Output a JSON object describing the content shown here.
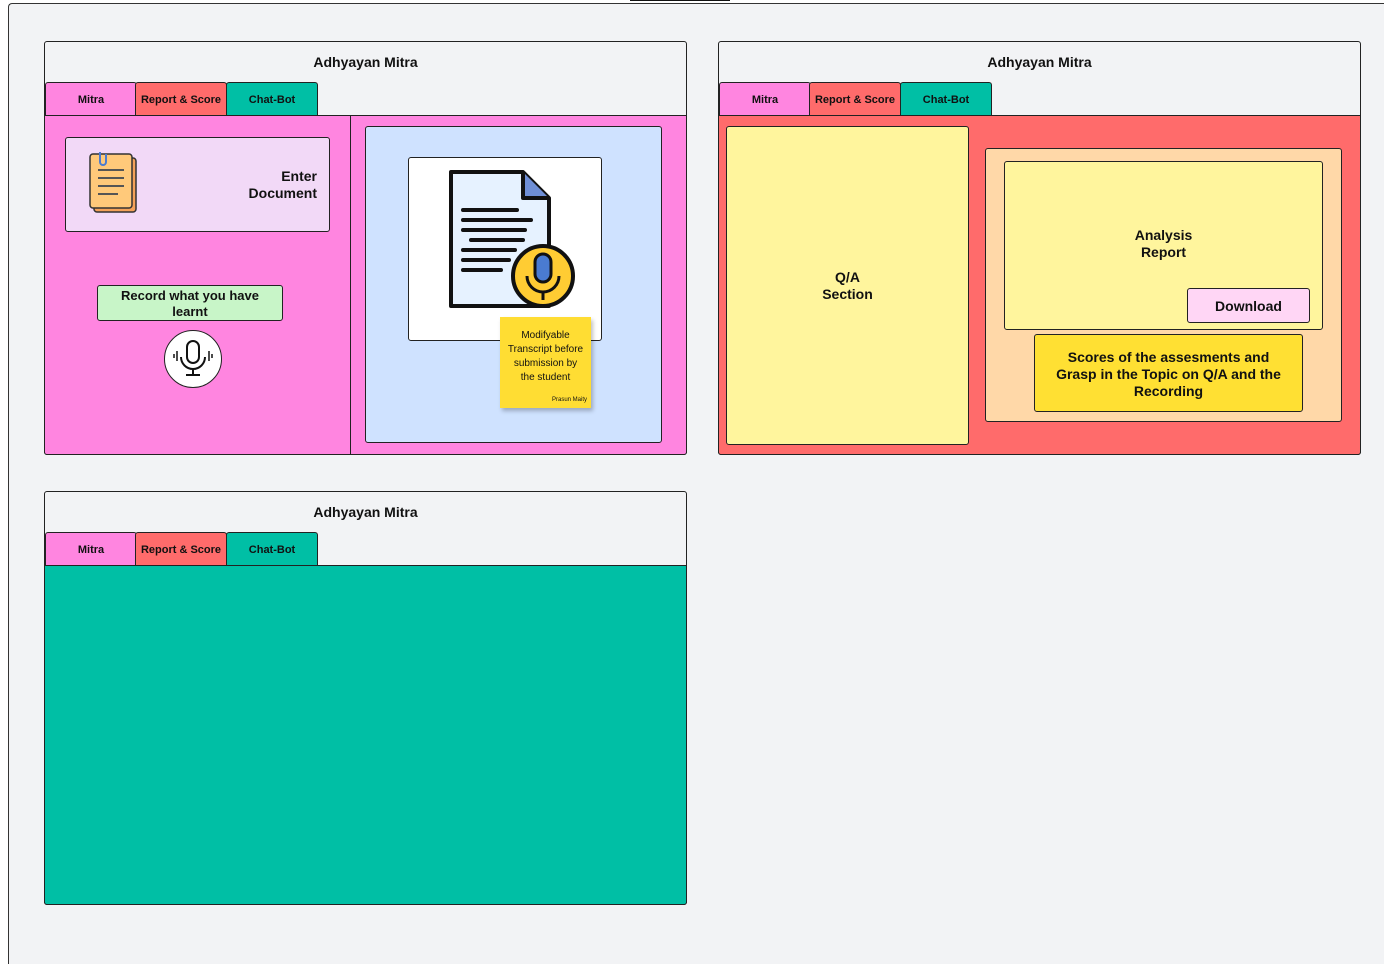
{
  "app": {
    "title": "Adhyayan Mitra",
    "tabs": [
      "Mitra",
      "Report & Score",
      "Chat-Bot"
    ]
  },
  "frame1": {
    "enter_document": [
      "Enter",
      "Document"
    ],
    "record_button": [
      "Record what you have",
      "learnt"
    ],
    "sticky_note": {
      "lines": [
        "Modifyable",
        "Transcript before",
        "submission by",
        "the student"
      ],
      "author": "Prasun Maity"
    }
  },
  "frame2": {
    "qa_section": [
      "Q/A",
      "Section"
    ],
    "analysis_report": [
      "Analysis",
      "Report"
    ],
    "download_label": "Download",
    "scores_text": [
      "Scores of the assesments and",
      "Grasp in the Topic on Q/A and the",
      "Recording"
    ]
  },
  "colors": {
    "mitra": "#ff85e0",
    "report": "#ff6b6b",
    "chatbot": "#00bfa5",
    "yellow": "#fff59d",
    "peach": "#ffd8a8",
    "sticky": "#ffdd33"
  }
}
